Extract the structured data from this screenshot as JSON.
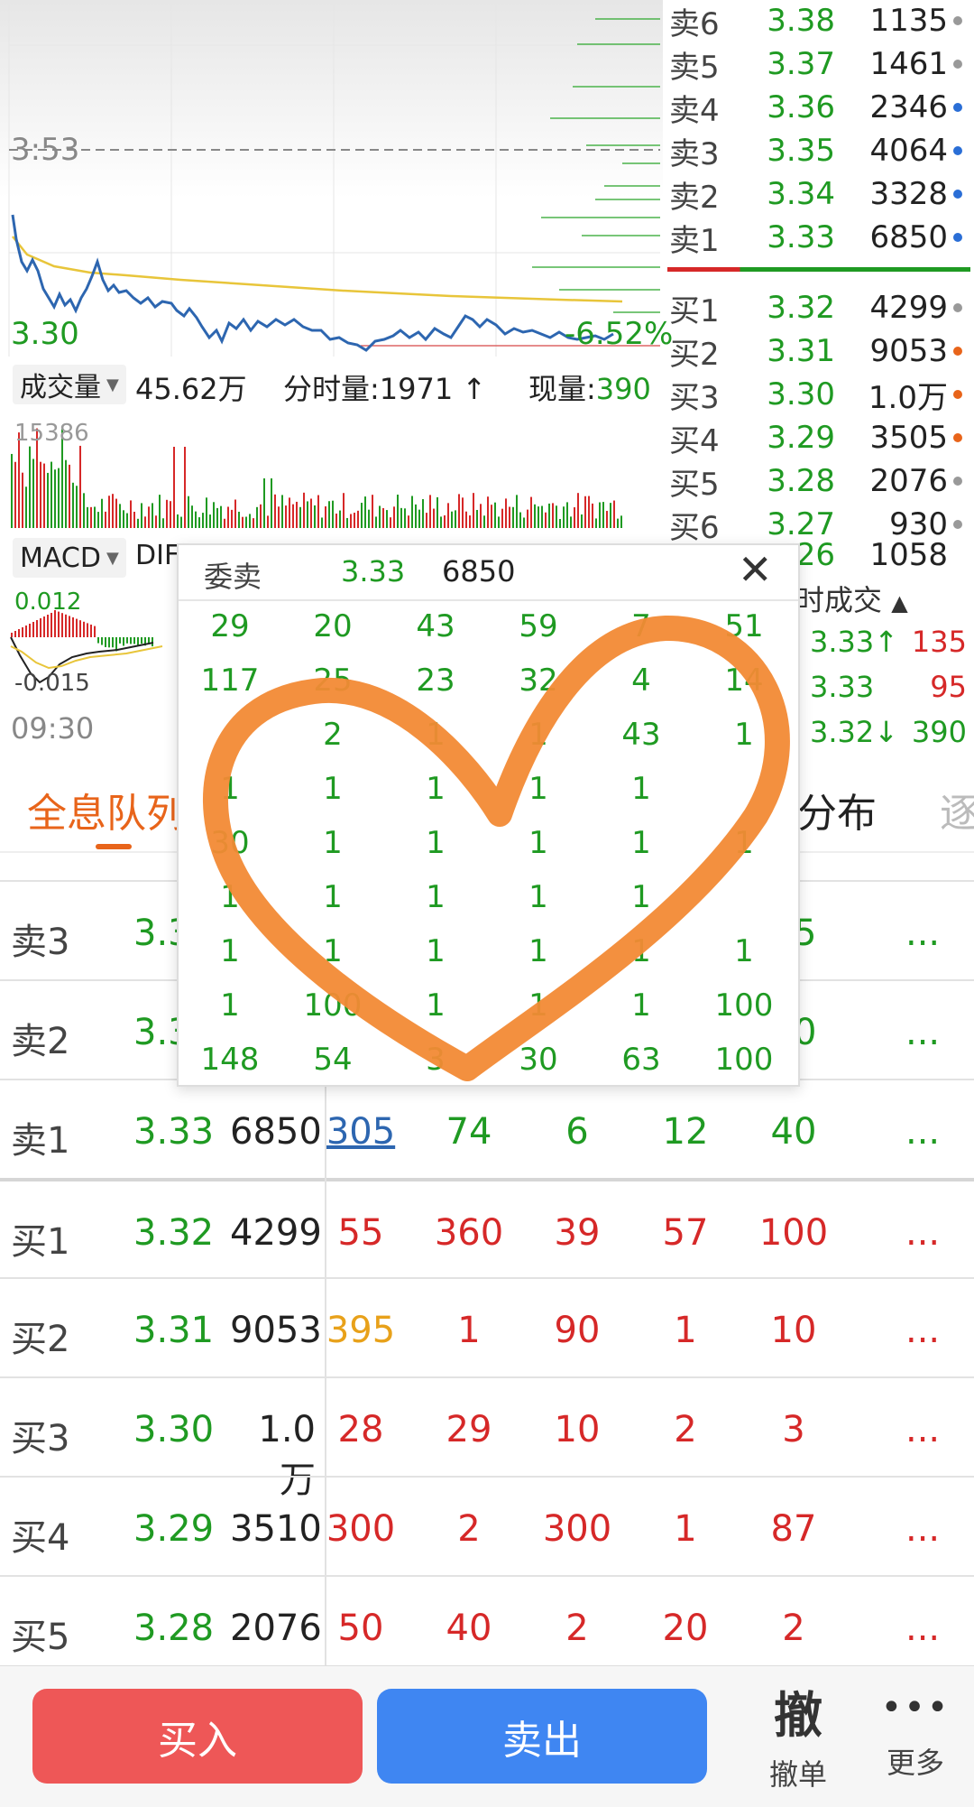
{
  "chart": {
    "ref_price": "3:53",
    "low_price": "3.30",
    "pct": "-6.52%",
    "vol_label": "成交量",
    "vol_total": "45.62万",
    "tick_vol": "分时量:1971",
    "now_vol_label": "现量:",
    "now_vol": "390",
    "vol_max": "15386",
    "macd_label": "MACD",
    "dif_label": "DIF",
    "macd_top": "0.012",
    "macd_bottom": "-0.015",
    "time_start": "09:30"
  },
  "orderbook": {
    "asks": [
      {
        "label": "卖6",
        "price": "3.38",
        "vol": "1135",
        "dot": "#999999"
      },
      {
        "label": "卖5",
        "price": "3.37",
        "vol": "1461",
        "dot": "#999999"
      },
      {
        "label": "卖4",
        "price": "3.36",
        "vol": "2346",
        "dot": "#2a6ed6"
      },
      {
        "label": "卖3",
        "price": "3.35",
        "vol": "4064",
        "dot": "#2a6ed6"
      },
      {
        "label": "卖2",
        "price": "3.34",
        "vol": "3328",
        "dot": "#2a6ed6"
      },
      {
        "label": "卖1",
        "price": "3.33",
        "vol": "6850",
        "dot": "#2a6ed6"
      }
    ],
    "bids": [
      {
        "label": "买1",
        "price": "3.32",
        "vol": "4299",
        "dot": "#999999"
      },
      {
        "label": "买2",
        "price": "3.31",
        "vol": "9053",
        "dot": "#e8641a"
      },
      {
        "label": "买3",
        "price": "3.30",
        "vol": "1.0万",
        "dot": "#e8641a"
      },
      {
        "label": "买4",
        "price": "3.29",
        "vol": "3505",
        "dot": "#e8641a"
      },
      {
        "label": "买5",
        "price": "3.28",
        "vol": "2076",
        "dot": "#999999"
      },
      {
        "label": "买6",
        "price": "3.27",
        "vol": "930",
        "dot": "#999999"
      }
    ],
    "partial_row": {
      "price": ".26",
      "vol": "1058"
    }
  },
  "trades": {
    "title": "时成交",
    "rows": [
      {
        "price": "3.33↑",
        "vol": "135"
      },
      {
        "price": "3.33",
        "vol": "95"
      },
      {
        "price": "3.32↓",
        "vol": "390"
      }
    ]
  },
  "tabs": {
    "active": "全息队列",
    "distribution": "分布",
    "more": "逐"
  },
  "depth": {
    "rows": [
      {
        "name": "卖3",
        "price": "3.3",
        "vol": "",
        "qty": [
          "",
          "",
          "",
          "",
          "15"
        ],
        "more": "..."
      },
      {
        "name": "卖2",
        "price": "3.3",
        "vol": "",
        "qty": [
          "",
          "",
          "",
          "",
          "30"
        ],
        "more": "..."
      },
      {
        "name": "卖1",
        "price": "3.33",
        "vol": "6850",
        "qty": [
          "305",
          "74",
          "6",
          "12",
          "40"
        ],
        "more": "..."
      },
      {
        "name": "买1",
        "price": "3.32",
        "vol": "4299",
        "qty": [
          "55",
          "360",
          "39",
          "57",
          "100"
        ],
        "more": "..."
      },
      {
        "name": "买2",
        "price": "3.31",
        "vol": "9053",
        "qty": [
          "395",
          "1",
          "90",
          "1",
          "10"
        ],
        "more": "..."
      },
      {
        "name": "买3",
        "price": "3.30",
        "vol": "1.0万",
        "qty": [
          "28",
          "29",
          "10",
          "2",
          "3"
        ],
        "more": "..."
      },
      {
        "name": "买4",
        "price": "3.29",
        "vol": "3510",
        "qty": [
          "300",
          "2",
          "300",
          "1",
          "87"
        ],
        "more": "..."
      },
      {
        "name": "买5",
        "price": "3.28",
        "vol": "2076",
        "qty": [
          "50",
          "40",
          "2",
          "20",
          "2"
        ],
        "more": "..."
      }
    ]
  },
  "popup": {
    "title": "委卖",
    "price": "3.33",
    "vol": "6850",
    "grid": [
      [
        "29",
        "20",
        "43",
        "59",
        "7",
        "51"
      ],
      [
        "117",
        "25",
        "23",
        "32",
        "4",
        "14"
      ],
      [
        "",
        "2",
        "1",
        "1",
        "43",
        "1"
      ],
      [
        "1",
        "1",
        "1",
        "1",
        "1",
        ""
      ],
      [
        "30",
        "1",
        "1",
        "1",
        "1",
        "1"
      ],
      [
        "1",
        "1",
        "1",
        "1",
        "1",
        ""
      ],
      [
        "1",
        "1",
        "1",
        "1",
        "1",
        "1"
      ],
      [
        "1",
        "100",
        "1",
        "1",
        "1",
        "100"
      ],
      [
        "148",
        "54",
        "3",
        "30",
        "63",
        "100"
      ]
    ]
  },
  "bottom": {
    "buy": "买入",
    "sell": "卖出",
    "cancel_glyph": "撤",
    "cancel_label": "撤单",
    "more_label": "更多",
    "buy_color": "#ee5757",
    "sell_color": "#3f86f2"
  }
}
